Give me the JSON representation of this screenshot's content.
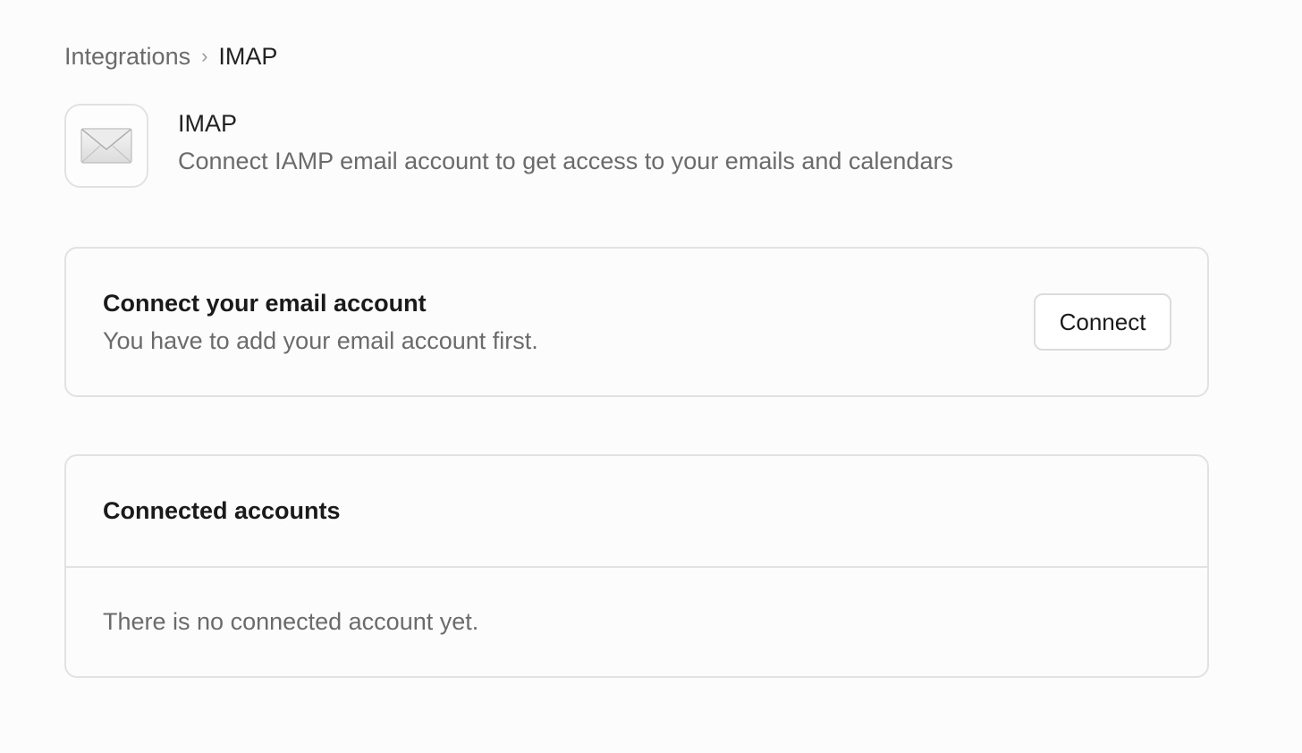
{
  "breadcrumb": {
    "parent": "Integrations",
    "separator": "›",
    "current": "IMAP"
  },
  "app": {
    "icon": "envelope-icon",
    "title": "IMAP",
    "description": "Connect IAMP email account to get access to your emails and calendars"
  },
  "connect_section": {
    "title": "Connect your email account",
    "subtitle": "You have to add your email account first.",
    "button_label": "Connect"
  },
  "accounts_section": {
    "title": "Connected accounts",
    "empty_message": "There is no connected account yet."
  }
}
